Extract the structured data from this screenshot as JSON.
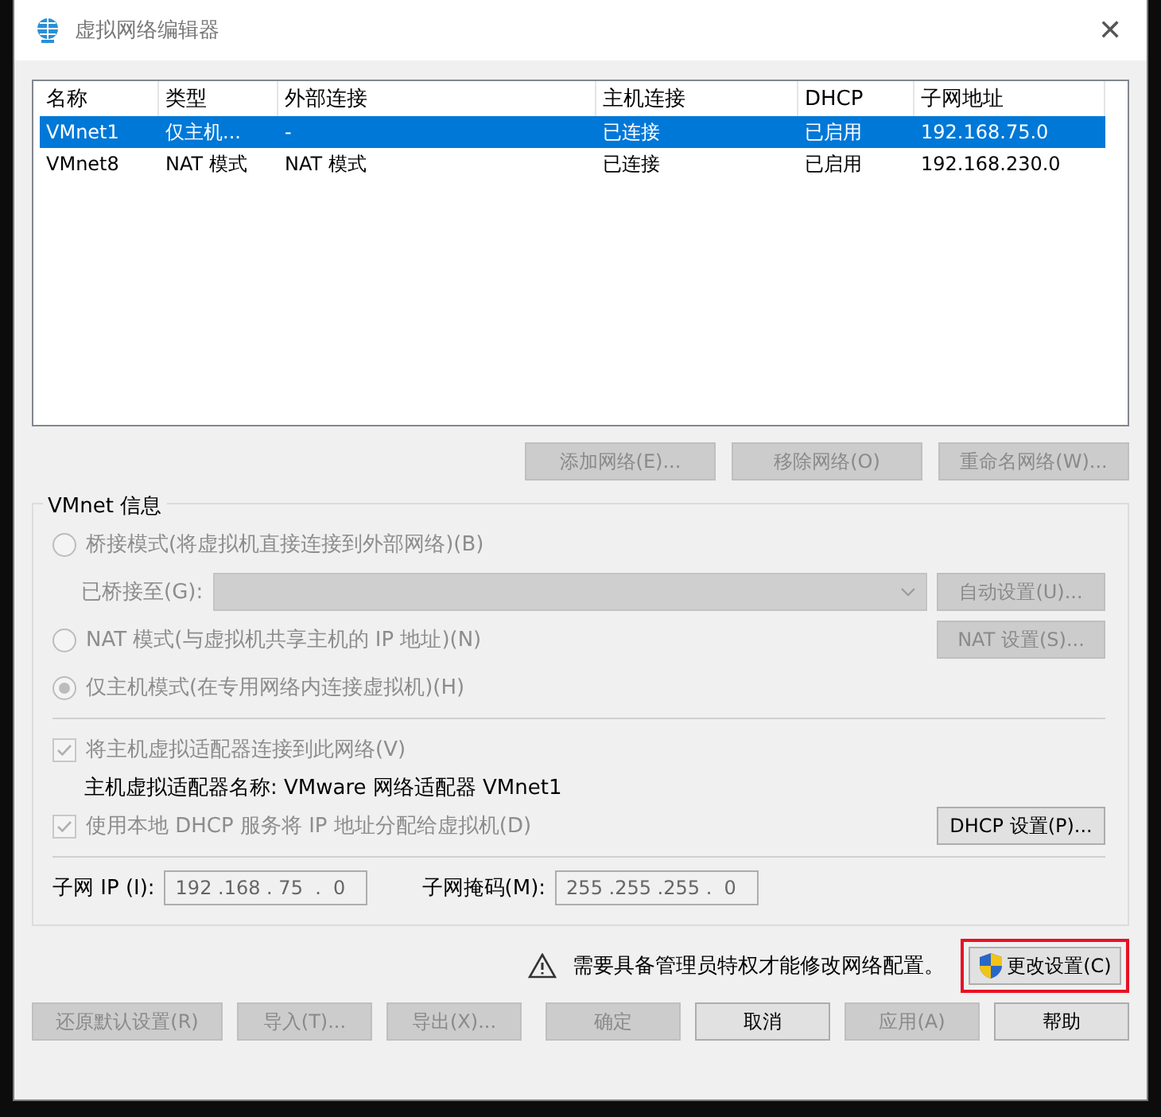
{
  "window": {
    "title": "虚拟网络编辑器",
    "close": "✕"
  },
  "table": {
    "columns": [
      "名称",
      "类型",
      "外部连接",
      "主机连接",
      "DHCP",
      "子网地址"
    ],
    "rows": [
      {
        "cells": [
          "VMnet1",
          "仅主机...",
          "-",
          "已连接",
          "已启用",
          "192.168.75.0"
        ],
        "selected": true
      },
      {
        "cells": [
          "VMnet8",
          "NAT 模式",
          "NAT 模式",
          "已连接",
          "已启用",
          "192.168.230.0"
        ],
        "selected": false
      }
    ]
  },
  "table_buttons": [
    {
      "label": "添加网络(E)...",
      "disabled": true
    },
    {
      "label": "移除网络(O)",
      "disabled": true
    },
    {
      "label": "重命名网络(W)...",
      "disabled": true
    }
  ],
  "vmnet_info": {
    "title": "VMnet 信息",
    "bridged": {
      "label": "桥接模式(将虚拟机直接连接到外部网络)(B)",
      "selected": false,
      "disabled": true
    },
    "bridged_to": {
      "label": "已桥接至(G):",
      "disabled": true
    },
    "auto_button": {
      "label": "自动设置(U)...",
      "disabled": true
    },
    "nat": {
      "label": "NAT 模式(与虚拟机共享主机的 IP 地址)(N)",
      "selected": false,
      "disabled": true
    },
    "nat_button": {
      "label": "NAT 设置(S)...",
      "disabled": true
    },
    "host_only": {
      "label": "仅主机模式(在专用网络内连接虚拟机)(H)",
      "selected": true,
      "disabled": true
    },
    "connect_adapter": {
      "label": "将主机虚拟适配器连接到此网络(V)",
      "checked": true,
      "disabled": true
    },
    "adapter_name": "主机虚拟适配器名称: VMware 网络适配器 VMnet1",
    "use_dhcp": {
      "label": "使用本地 DHCP 服务将 IP 地址分配给虚拟机(D)",
      "checked": true,
      "disabled": true
    },
    "dhcp_button": {
      "label": "DHCP 设置(P)...",
      "disabled": false
    },
    "subnet_ip": {
      "label": "子网 IP (I):",
      "value": "192 .168 . 75  .  0"
    },
    "subnet_mask": {
      "label": "子网掩码(M):",
      "value": "255 .255 .255 .  0"
    }
  },
  "warning": {
    "text": "需要具备管理员特权才能修改网络配置。"
  },
  "change_button": {
    "label": "更改设置(C)",
    "highlighted": true
  },
  "footer_buttons": [
    {
      "label": "还原默认设置(R)",
      "disabled": true
    },
    {
      "label": "导入(T)...",
      "disabled": true
    },
    {
      "label": "导出(X)...",
      "disabled": true
    },
    {
      "label": "确定",
      "disabled": true
    },
    {
      "label": "取消",
      "disabled": false
    },
    {
      "label": "应用(A)",
      "disabled": true
    },
    {
      "label": "帮助",
      "disabled": false
    }
  ]
}
